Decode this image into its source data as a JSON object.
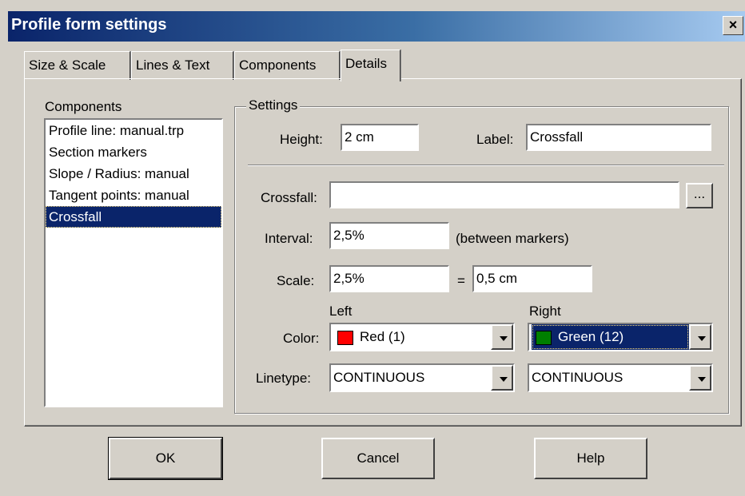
{
  "window": {
    "title": "Profile form settings",
    "close_label": "×"
  },
  "tabs": [
    {
      "label": "Size & Scale"
    },
    {
      "label": "Lines & Text"
    },
    {
      "label": "Components"
    },
    {
      "label": "Details"
    }
  ],
  "active_tab": "Details",
  "components": {
    "label": "Components",
    "items": [
      "Profile line: manual.trp",
      "Section markers",
      "Slope / Radius: manual",
      "Tangent points: manual",
      "Crossfall"
    ],
    "selected": "Crossfall"
  },
  "settings": {
    "group_label": "Settings",
    "height_label": "Height:",
    "height_value": "2 cm",
    "label_label": "Label:",
    "label_value": "Crossfall",
    "crossfall_label": "Crossfall:",
    "crossfall_value": "",
    "browse_label": "...",
    "interval_label": "Interval:",
    "interval_value": "2,5%",
    "interval_note": "(between markers)",
    "scale_label": "Scale:",
    "scale_value": "2,5%",
    "equals": "=",
    "scale_result": "0,5 cm",
    "left_label": "Left",
    "right_label": "Right",
    "color_label": "Color:",
    "color_left": {
      "value": "Red (1)",
      "swatch": "#ff0000"
    },
    "color_right": {
      "value": "Green (12)",
      "swatch": "#007f00"
    },
    "linetype_label": "Linetype:",
    "linetype_left": "CONTINUOUS",
    "linetype_right": "CONTINUOUS"
  },
  "buttons": {
    "ok": "OK",
    "cancel": "Cancel",
    "help": "Help"
  }
}
